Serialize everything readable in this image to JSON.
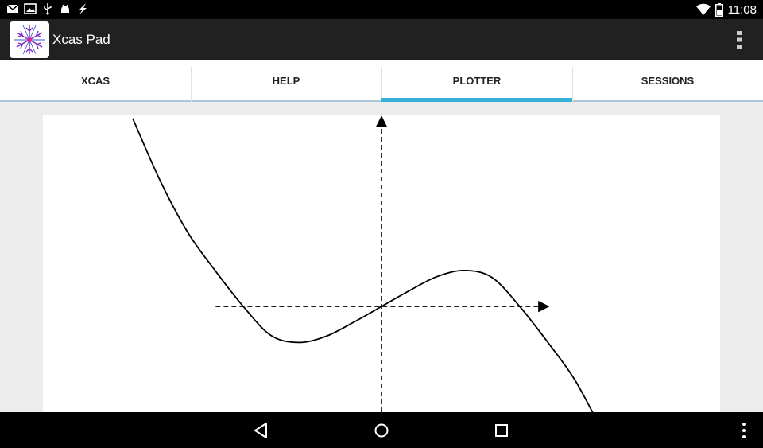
{
  "status_bar": {
    "time": "11:08",
    "left_icons": [
      "gmail-icon",
      "gallery-icon",
      "usb-icon",
      "android-debug-icon",
      "charging-bolt-icon"
    ],
    "right_icons": [
      "wifi-icon",
      "battery-icon"
    ]
  },
  "app_bar": {
    "title": "Xcas Pad",
    "icon": "xcas-snowflake-icon"
  },
  "tabs": [
    {
      "label": "XCAS",
      "active": false
    },
    {
      "label": "HELP",
      "active": false
    },
    {
      "label": "PLOTTER",
      "active": true
    },
    {
      "label": "SESSIONS",
      "active": false
    }
  ],
  "colors": {
    "accent": "#35b1d8",
    "action_bar": "#212121",
    "background": "#ececec"
  },
  "chart_data": {
    "type": "line",
    "title": "",
    "xlabel": "",
    "ylabel": "",
    "grid": false,
    "axes_style": "dashed with arrowheads",
    "xlim": [
      -2.45,
      2.45
    ],
    "ylim": [
      -1.35,
      2.45
    ],
    "series": [
      {
        "x": [
          -1.8,
          -1.6,
          -1.4,
          -1.2,
          -1.0,
          -0.8,
          -0.6,
          -0.4,
          -0.2,
          0.0,
          0.2,
          0.4,
          0.6,
          0.8,
          1.0,
          1.2,
          1.4,
          1.6
        ],
        "y": [
          2.4,
          1.6,
          0.94,
          0.45,
          0.0,
          -0.37,
          -0.46,
          -0.38,
          -0.2,
          0.0,
          0.2,
          0.38,
          0.46,
          0.37,
          0.0,
          -0.45,
          -0.94,
          -1.6
        ]
      }
    ]
  },
  "nav_bar": {
    "buttons": [
      "back-icon",
      "home-icon",
      "recents-icon",
      "menu-icon"
    ]
  }
}
